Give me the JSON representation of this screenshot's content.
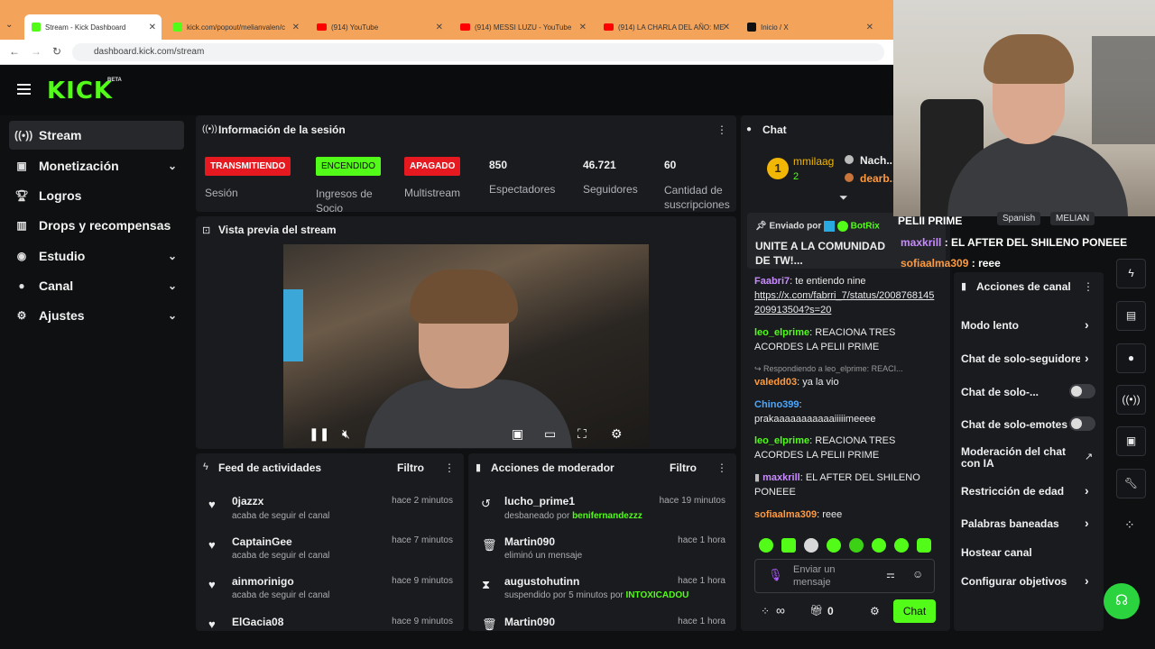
{
  "browser": {
    "tabs": [
      {
        "label": "Stream - Kick Dashboard",
        "icon": "kick-icon"
      },
      {
        "label": "kick.com/popout/melianvalen/c",
        "icon": "kick-icon"
      },
      {
        "label": "(914) YouTube",
        "icon": "youtube-icon"
      },
      {
        "label": "(914) MESSI LUZU - YouTube",
        "icon": "youtube-icon"
      },
      {
        "label": "(914) LA CHARLA DEL AÑO: ME",
        "icon": "youtube-icon"
      },
      {
        "label": "Inicio / X",
        "icon": "x-icon"
      }
    ],
    "url": "dashboard.kick.com/stream"
  },
  "brand": {
    "logo": "KICK",
    "beta": "BETA",
    "accent": "#53fc18"
  },
  "sidebar": {
    "items": [
      {
        "label": "Stream",
        "icon": "broadcast-icon"
      },
      {
        "label": "Monetización",
        "icon": "money-icon"
      },
      {
        "label": "Logros",
        "icon": "trophy-icon"
      },
      {
        "label": "Drops y recompensas",
        "icon": "chart-icon"
      },
      {
        "label": "Estudio",
        "icon": "studio-icon"
      },
      {
        "label": "Canal",
        "icon": "user-icon"
      },
      {
        "label": "Ajustes",
        "icon": "gear-icon"
      }
    ]
  },
  "session": {
    "title": "Información de la sesión",
    "status": [
      {
        "badge": "TRANSMITIENDO",
        "label": "Sesión",
        "color": "#e5191f"
      },
      {
        "badge": "ENCENDIDO",
        "label": "Ingresos de Socio",
        "color": "#53fc18"
      },
      {
        "badge": "APAGADO",
        "label": "Multistream",
        "color": "#e5191f"
      }
    ],
    "stats": [
      {
        "value": "850",
        "label": "Espectadores"
      },
      {
        "value": "46.721",
        "label": "Seguidores"
      },
      {
        "value": "60",
        "label": "Cantidad de suscripciones"
      }
    ]
  },
  "preview": {
    "title": "Vista previa del stream"
  },
  "activity": {
    "title": "Feed de actividades",
    "filter": "Filtro",
    "items": [
      {
        "name": "0jazzx",
        "action": "acaba de seguir el canal",
        "time": "hace 2 minutos"
      },
      {
        "name": "CaptainGee",
        "action": "acaba de seguir el canal",
        "time": "hace 7 minutos"
      },
      {
        "name": "ainmorinigo",
        "action": "acaba de seguir el canal",
        "time": "hace 9 minutos"
      },
      {
        "name": "ElGacia08",
        "action": "",
        "time": "hace 9 minutos"
      }
    ]
  },
  "modactions": {
    "title": "Acciones de moderador",
    "filter": "Filtro",
    "items": [
      {
        "name": "lucho_prime1",
        "action": "desbaneado por",
        "by": "benifernandezzz",
        "time": "hace 19 minutos",
        "icon": "undo-icon"
      },
      {
        "name": "Martin090",
        "action": "eliminó un mensaje",
        "by": "",
        "time": "hace 1 hora",
        "icon": "trash-icon"
      },
      {
        "name": "augustohutinn",
        "action": "suspendido por 5 minutos por",
        "by": "INTOXICADOU",
        "time": "hace 1 hora",
        "icon": "hourglass-icon"
      },
      {
        "name": "Martin090",
        "action": "",
        "by": "",
        "time": "hace 1 hora",
        "icon": "trash-icon"
      }
    ]
  },
  "chat": {
    "title": "Chat",
    "leaderboard": [
      {
        "name": "mmilaag",
        "count": "2"
      },
      {
        "name": "Nach..",
        "count": ""
      },
      {
        "name": "dearb..",
        "count": ""
      }
    ],
    "pinned": {
      "sent_by": "Enviado por",
      "bot": "BotRix",
      "text": "UNITE A LA COMUNIDAD DE TW!..."
    },
    "messages": [
      {
        "user": "Faabri7",
        "color": "#c98bff",
        "text": "te entiendo nine",
        "link": "https://x.com/fabrri_7/status/2008768145209913504?s=20"
      },
      {
        "user": "leo_elprime",
        "color": "#53fc18",
        "text": "REACIONA TRES ACORDES LA PELII PRIME"
      },
      {
        "reply": "Respondiendo a leo_elprime: REACI...",
        "user": "valedd03",
        "color": "#ff9a3d",
        "text": "ya la vio"
      },
      {
        "user": "Chino399",
        "color": "#4aa8ff",
        "text": "prakaaaaaaaaaaaiiiiimeeee"
      },
      {
        "user": "leo_elprime",
        "color": "#53fc18",
        "text": "REACIONA TRES ACORDES LA PELII PRIME"
      },
      {
        "user": "maxkrill",
        "color": "#c98bff",
        "text": "EL AFTER DEL SHILENO PONEEE"
      },
      {
        "user": "sofiaalma309",
        "color": "#ff9a3d",
        "text": "reee"
      }
    ],
    "placeholder": "Enviar un mensaje",
    "points": "∞",
    "gifts": "0",
    "send": "Chat"
  },
  "overlay": {
    "title": "PELII PRIME",
    "tags": [
      "Spanish",
      "MELIAN"
    ],
    "lines": [
      {
        "user": "maxkrill",
        "text": "EL AFTER DEL SHILENO PONEEE",
        "color": "#c98bff"
      },
      {
        "user": "sofiaalma309",
        "text": "reee",
        "color": "#ff9a3d"
      }
    ]
  },
  "actions": {
    "title": "Acciones de canal",
    "items": [
      {
        "label": "Modo lento",
        "type": "chevron"
      },
      {
        "label": "Chat de solo-seguidore",
        "type": "chevron"
      },
      {
        "label": "Chat de solo-...",
        "type": "toggle"
      },
      {
        "label": "Chat de solo-emotes",
        "type": "toggle"
      },
      {
        "label": "Moderación del chat con IA",
        "type": "external"
      },
      {
        "label": "Restricción de edad",
        "type": "chevron"
      },
      {
        "label": "Palabras baneadas",
        "type": "chevron"
      },
      {
        "label": "Hostear canal",
        "type": "none"
      },
      {
        "label": "Configurar objetivos",
        "type": "chevron"
      }
    ]
  }
}
